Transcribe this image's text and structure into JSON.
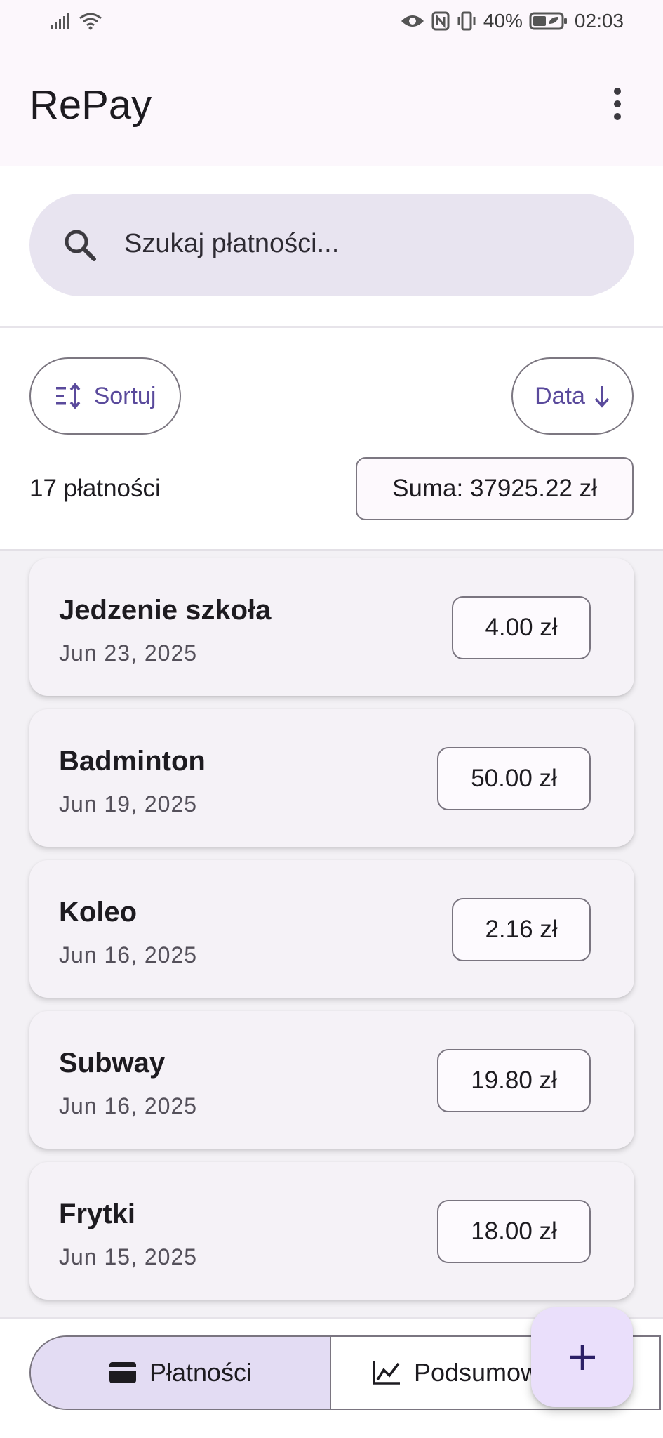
{
  "status_bar": {
    "battery": "40%",
    "time": "02:03",
    "icons": [
      "signal-icon",
      "wifi-icon",
      "eye-icon",
      "nfc-icon",
      "vibrate-icon",
      "battery-icon"
    ]
  },
  "app_bar": {
    "title": "RePay",
    "menu_icon": "more-vert-icon"
  },
  "search": {
    "placeholder": "Szukaj płatności...",
    "icon": "search-icon"
  },
  "controls": {
    "sort_label": "Sortuj",
    "sort_icon": "sort-icon",
    "date_label": "Data",
    "date_icon": "arrow-down-icon"
  },
  "summary": {
    "count": "17 płatności",
    "total": "Suma: 37925.22 zł"
  },
  "payments": [
    {
      "title": "Jedzenie szkoła",
      "date": "Jun 23, 2025",
      "amount": "4.00 zł"
    },
    {
      "title": "Badminton",
      "date": "Jun 19, 2025",
      "amount": "50.00 zł"
    },
    {
      "title": "Koleo",
      "date": "Jun 16, 2025",
      "amount": "2.16 zł"
    },
    {
      "title": "Subway",
      "date": "Jun 16, 2025",
      "amount": "19.80 zł"
    },
    {
      "title": "Frytki",
      "date": "Jun 15, 2025",
      "amount": "18.00 zł"
    }
  ],
  "bottom_nav": {
    "payments_label": "Płatności",
    "payments_icon": "card-icon",
    "summary_label": "Podsumowanie",
    "summary_icon": "chart-icon"
  },
  "fab": {
    "icon": "add-icon",
    "symbol": "+"
  },
  "colors": {
    "accent": "#5a4a9c",
    "search_bg": "#e8e4f0",
    "segment_active": "#e3dcf3",
    "fab_bg": "#eadffb"
  }
}
